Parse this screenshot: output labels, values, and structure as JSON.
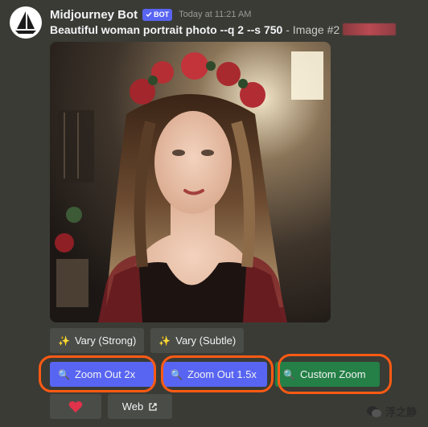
{
  "message": {
    "username": "Midjourney Bot",
    "bot_badge": "BOT",
    "timestamp": "Today at 11:21 AM",
    "prompt_bold": "Beautiful woman portrait photo --q 2 --s 750",
    "prompt_rest": " - Image #2"
  },
  "buttons": {
    "vary_strong": "Vary (Strong)",
    "vary_subtle": "Vary (Subtle)",
    "zoom_out_2x": "Zoom Out 2x",
    "zoom_out_1_5x": "Zoom Out 1.5x",
    "custom_zoom": "Custom Zoom",
    "web": "Web"
  },
  "watermark": {
    "text": "浮之静"
  },
  "colors": {
    "background": "#3a3b35",
    "blurple": "#5865f2",
    "green": "#248046",
    "highlight": "#ff5a14",
    "heart": "#e0324b"
  }
}
